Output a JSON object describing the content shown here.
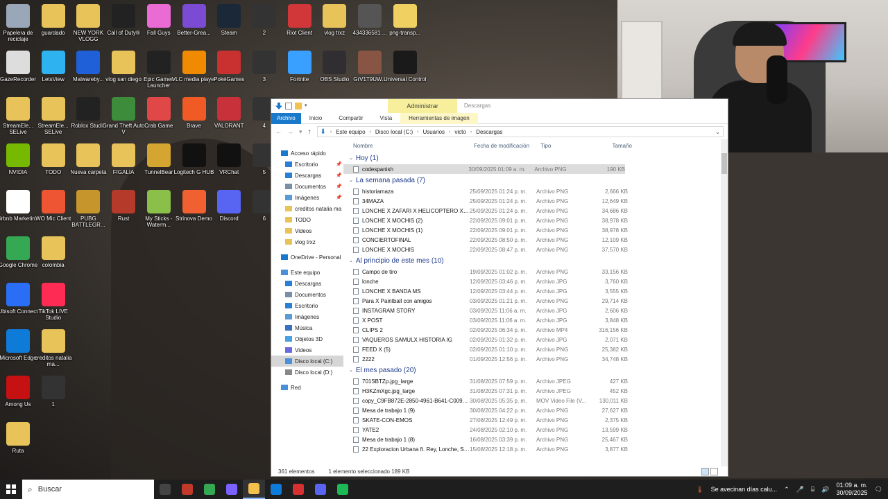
{
  "desktop_icons": [
    {
      "label": "Papelera de reciclaje",
      "color": "#9aa7b8"
    },
    {
      "label": "guardado",
      "color": "#e8c35a"
    },
    {
      "label": "NEW YORK VLOGG",
      "color": "#e8c35a"
    },
    {
      "label": "Call of Duty®",
      "color": "#222222"
    },
    {
      "label": "Fall Guys",
      "color": "#e96bd3"
    },
    {
      "label": "Better-Grea...",
      "color": "#7b4bd3"
    },
    {
      "label": "Steam",
      "color": "#1b2838"
    },
    {
      "label": "2",
      "color": "#333333"
    },
    {
      "label": "Riot Client",
      "color": "#d13639"
    },
    {
      "label": "vlog trxz",
      "color": "#e8c35a"
    },
    {
      "label": "434336581 ...",
      "color": "#555555"
    },
    {
      "label": "png-transp...",
      "color": "#f0d060"
    },
    {
      "label": "GazeRecorder",
      "color": "#dddddd"
    },
    {
      "label": "LetsView",
      "color": "#2fb3f0"
    },
    {
      "label": "Malwareby...",
      "color": "#1f5fd8"
    },
    {
      "label": "vlog san diego",
      "color": "#e8c35a"
    },
    {
      "label": "Epic Games Launcher",
      "color": "#222222"
    },
    {
      "label": "VLC media player",
      "color": "#f08a00"
    },
    {
      "label": "PokéGames",
      "color": "#c93030"
    },
    {
      "label": "3",
      "color": "#333333"
    },
    {
      "label": "Fortnite",
      "color": "#3aa0ff"
    },
    {
      "label": "OBS Studio",
      "color": "#302e31"
    },
    {
      "label": "GrV1T9UW...",
      "color": "#885544"
    },
    {
      "label": "Universal Control",
      "color": "#1a1a1a"
    },
    {
      "label": "StreamEle... SELive",
      "color": "#e8c35a"
    },
    {
      "label": "StreamEle... SELive",
      "color": "#e8c35a"
    },
    {
      "label": "Roblox Studio",
      "color": "#222222"
    },
    {
      "label": "Grand Theft Auto V",
      "color": "#3c8c3c"
    },
    {
      "label": "Crab Game",
      "color": "#e04848"
    },
    {
      "label": "Brave",
      "color": "#f05a24"
    },
    {
      "label": "VALORANT",
      "color": "#c8303a"
    },
    {
      "label": "4",
      "color": "#333333"
    },
    {
      "label": "NVIDIA",
      "color": "#76b900"
    },
    {
      "label": "TODO",
      "color": "#e8c35a"
    },
    {
      "label": "Nueva carpeta",
      "color": "#e8c35a"
    },
    {
      "label": "FIGALIA",
      "color": "#e8c35a"
    },
    {
      "label": "TunnelBear",
      "color": "#d4a531"
    },
    {
      "label": "Logitech G HUB",
      "color": "#111111"
    },
    {
      "label": "VRChat",
      "color": "#111111"
    },
    {
      "label": "5",
      "color": "#333333"
    },
    {
      "label": "Airbnb Marketin...",
      "color": "#ffffff"
    },
    {
      "label": "WO Mic Client",
      "color": "#ee5533"
    },
    {
      "label": "PUBG BATTLEGR...",
      "color": "#c6962c"
    },
    {
      "label": "Rust",
      "color": "#b53a2a"
    },
    {
      "label": "My Sticks - Waterm...",
      "color": "#8abf4a"
    },
    {
      "label": "Strinova Demo",
      "color": "#f06030"
    },
    {
      "label": "Discord",
      "color": "#5865f2"
    },
    {
      "label": "6",
      "color": "#333333"
    },
    {
      "label": "Google Chrome",
      "color": "#34a853"
    },
    {
      "label": "colombia",
      "color": "#e8c35a"
    },
    {
      "label": "Ubisoft Connect",
      "color": "#2a6ef5"
    },
    {
      "label": "TikTok LIVE Studio",
      "color": "#fe2c55"
    },
    {
      "label": "Microsoft Edge",
      "color": "#0f7bd8"
    },
    {
      "label": "creditos natalia ma...",
      "color": "#e8c35a"
    },
    {
      "label": "Among Us",
      "color": "#c51111"
    },
    {
      "label": "1",
      "color": "#333333"
    },
    {
      "label": "Ruta",
      "color": "#e8c35a"
    }
  ],
  "explorer": {
    "context_tab": "Administrar",
    "window_title": "Descargas",
    "tabs": [
      "Archivo",
      "Inicio",
      "Compartir",
      "Vista",
      "Herramientas de imagen"
    ],
    "breadcrumb": [
      "Este equipo",
      "Disco local (C:)",
      "Usuarios",
      "victo",
      "Descargas"
    ],
    "nav": [
      {
        "label": "Acceso rápido",
        "color": "#1979ca",
        "pin": false
      },
      {
        "label": "Escritorio",
        "color": "#2a7fd4",
        "pin": true
      },
      {
        "label": "Descargas",
        "color": "#2a7fd4",
        "pin": true
      },
      {
        "label": "Documentos",
        "color": "#7a8fa6",
        "pin": true
      },
      {
        "label": "Imágenes",
        "color": "#5a9bd4",
        "pin": true
      },
      {
        "label": "creditos natalia ma",
        "color": "#e8c35a",
        "pin": false
      },
      {
        "label": "TODO",
        "color": "#e8c35a",
        "pin": false
      },
      {
        "label": "Videos",
        "color": "#e8c35a",
        "pin": false
      },
      {
        "label": "vlog trxz",
        "color": "#e8c35a",
        "pin": false
      },
      {
        "label": "",
        "color": "",
        "pin": false
      },
      {
        "label": "OneDrive - Personal",
        "color": "#1979ca",
        "pin": false
      },
      {
        "label": "",
        "color": "",
        "pin": false
      },
      {
        "label": "Este equipo",
        "color": "#4a90d9",
        "pin": false
      },
      {
        "label": "Descargas",
        "color": "#2a7fd4",
        "pin": false
      },
      {
        "label": "Documentos",
        "color": "#7a8fa6",
        "pin": false
      },
      {
        "label": "Escritorio",
        "color": "#2a7fd4",
        "pin": false
      },
      {
        "label": "Imágenes",
        "color": "#5a9bd4",
        "pin": false
      },
      {
        "label": "Música",
        "color": "#3a70c0",
        "pin": false
      },
      {
        "label": "Objetos 3D",
        "color": "#4aa0e0",
        "pin": false
      },
      {
        "label": "Videos",
        "color": "#6a6ae0",
        "pin": false
      },
      {
        "label": "Disco local (C:)",
        "color": "#4a90d9",
        "pin": false,
        "selected": true
      },
      {
        "label": "Disco local (D:)",
        "color": "#888888",
        "pin": false
      },
      {
        "label": "",
        "color": "",
        "pin": false
      },
      {
        "label": "Red",
        "color": "#4a90d9",
        "pin": false
      }
    ],
    "columns": [
      "Nombre",
      "Fecha de modificación",
      "Tipo",
      "Tamaño"
    ],
    "groups": [
      {
        "title": "Hoy (1)",
        "files": [
          {
            "name": "codespanish",
            "date": "30/09/2025 01:09 a. m.",
            "type": "Archivo PNG",
            "size": "190 KB",
            "selected": true
          }
        ]
      },
      {
        "title": "La semana pasada (7)",
        "files": [
          {
            "name": "historiamaza",
            "date": "25/09/2025 01:24 p. m.",
            "type": "Archivo PNG",
            "size": "2,666 KB"
          },
          {
            "name": "34MAZA",
            "date": "25/09/2025 01:24 p. m.",
            "type": "Archivo PNG",
            "size": "12,649 KB"
          },
          {
            "name": "LONCHE X ZAFARI X HELICOPTERO X YATE",
            "date": "25/09/2025 01:24 p. m.",
            "type": "Archivo PNG",
            "size": "34,686 KB"
          },
          {
            "name": "LONCHE X MOCHIS (2)",
            "date": "22/09/2025 09:01 p. m.",
            "type": "Archivo PNG",
            "size": "38,978 KB"
          },
          {
            "name": "LONCHE X MOCHIS (1)",
            "date": "22/09/2025 09:01 p. m.",
            "type": "Archivo PNG",
            "size": "38,978 KB"
          },
          {
            "name": "CONCIERTOFINAL",
            "date": "22/09/2025 08:50 p. m.",
            "type": "Archivo PNG",
            "size": "12,109 KB"
          },
          {
            "name": "LONCHE X MOCHIS",
            "date": "22/09/2025 08:47 p. m.",
            "type": "Archivo PNG",
            "size": "37,570 KB"
          }
        ]
      },
      {
        "title": "Al principio de este mes (10)",
        "files": [
          {
            "name": "Campo de tiro",
            "date": "19/09/2025 01:02 p. m.",
            "type": "Archivo PNG",
            "size": "33,156 KB"
          },
          {
            "name": "lonche",
            "date": "12/09/2025 03:46 p. m.",
            "type": "Archivo JPG",
            "size": "3,760 KB"
          },
          {
            "name": "LONCHE X BANDA MS",
            "date": "12/09/2025 03:44 p. m.",
            "type": "Archivo JPG",
            "size": "3,555 KB"
          },
          {
            "name": "Para X Paintball con amigos",
            "date": "03/09/2025 01:21 p. m.",
            "type": "Archivo PNG",
            "size": "29,714 KB"
          },
          {
            "name": "INSTAGRAM STORY",
            "date": "03/09/2025 11:06 a. m.",
            "type": "Archivo JPG",
            "size": "2,606 KB"
          },
          {
            "name": "X POST",
            "date": "03/09/2025 11:06 a. m.",
            "type": "Archivo JPG",
            "size": "3,848 KB"
          },
          {
            "name": "CLIPS 2",
            "date": "02/09/2025 06:34 p. m.",
            "type": "Archivo MP4",
            "size": "316,156 KB"
          },
          {
            "name": "VAQUEROS SAMULX HISTORIA IG",
            "date": "02/09/2025 01:32 p. m.",
            "type": "Archivo JPG",
            "size": "2,071 KB"
          },
          {
            "name": "FEED X (5)",
            "date": "02/09/2025 01:10 p. m.",
            "type": "Archivo PNG",
            "size": "25,382 KB"
          },
          {
            "name": "2222",
            "date": "01/09/2025 12:56 p. m.",
            "type": "Archivo PNG",
            "size": "34,748 KB"
          }
        ]
      },
      {
        "title": "El mes pasado (20)",
        "files": [
          {
            "name": "701SBTZp.jpg_large",
            "date": "31/08/2025 07:59 p. m.",
            "type": "Archivo JPEG",
            "size": "427 KB"
          },
          {
            "name": "H3KZmXgc.jpg_large",
            "date": "31/08/2025 07:31 p. m.",
            "type": "Archivo JPEG",
            "size": "452 KB"
          },
          {
            "name": "copy_C9FB872E-2850-4961-B641-C0091A...",
            "date": "30/08/2025 05:35 p. m.",
            "type": "MOV Video File (V...",
            "size": "130,011 KB"
          },
          {
            "name": "Mesa de trabajo 1 (9)",
            "date": "30/08/2025 04:22 p. m.",
            "type": "Archivo PNG",
            "size": "27,627 KB"
          },
          {
            "name": "SKATE-CON-EMOS",
            "date": "27/08/2025 12:49 p. m.",
            "type": "Archivo PNG",
            "size": "2,375 KB"
          },
          {
            "name": "YATE2",
            "date": "24/08/2025 02:10 p. m.",
            "type": "Archivo PNG",
            "size": "13,599 KB"
          },
          {
            "name": "Mesa de trabajo 1 (8)",
            "date": "16/08/2025 03:39 p. m.",
            "type": "Archivo PNG",
            "size": "25,467 KB"
          },
          {
            "name": "22 Exploracion Urbana ft. Rey, Lonche, Sa...",
            "date": "15/08/2025 12:18 p. m.",
            "type": "Archivo PNG",
            "size": "3,877 KB"
          }
        ]
      }
    ],
    "status_count": "361 elementos",
    "status_selected": "1 elemento seleccionado  189 KB"
  },
  "taskbar": {
    "search_placeholder": "Buscar",
    "apps": [
      {
        "name": "task-view",
        "color": "#444444"
      },
      {
        "name": "app-red",
        "color": "#c0392b"
      },
      {
        "name": "chrome",
        "color": "#34a853"
      },
      {
        "name": "copilot",
        "color": "#7b61ff"
      },
      {
        "name": "file-explorer",
        "color": "#f2c14e",
        "active": true
      },
      {
        "name": "store",
        "color": "#0f7bd8"
      },
      {
        "name": "app-red-2",
        "color": "#d63031"
      },
      {
        "name": "discord",
        "color": "#5865f2"
      },
      {
        "name": "spotify",
        "color": "#1db954"
      }
    ],
    "weather_text": "Se avecinan días calu...",
    "time": "01:09 a. m.",
    "date": "30/09/2025"
  }
}
